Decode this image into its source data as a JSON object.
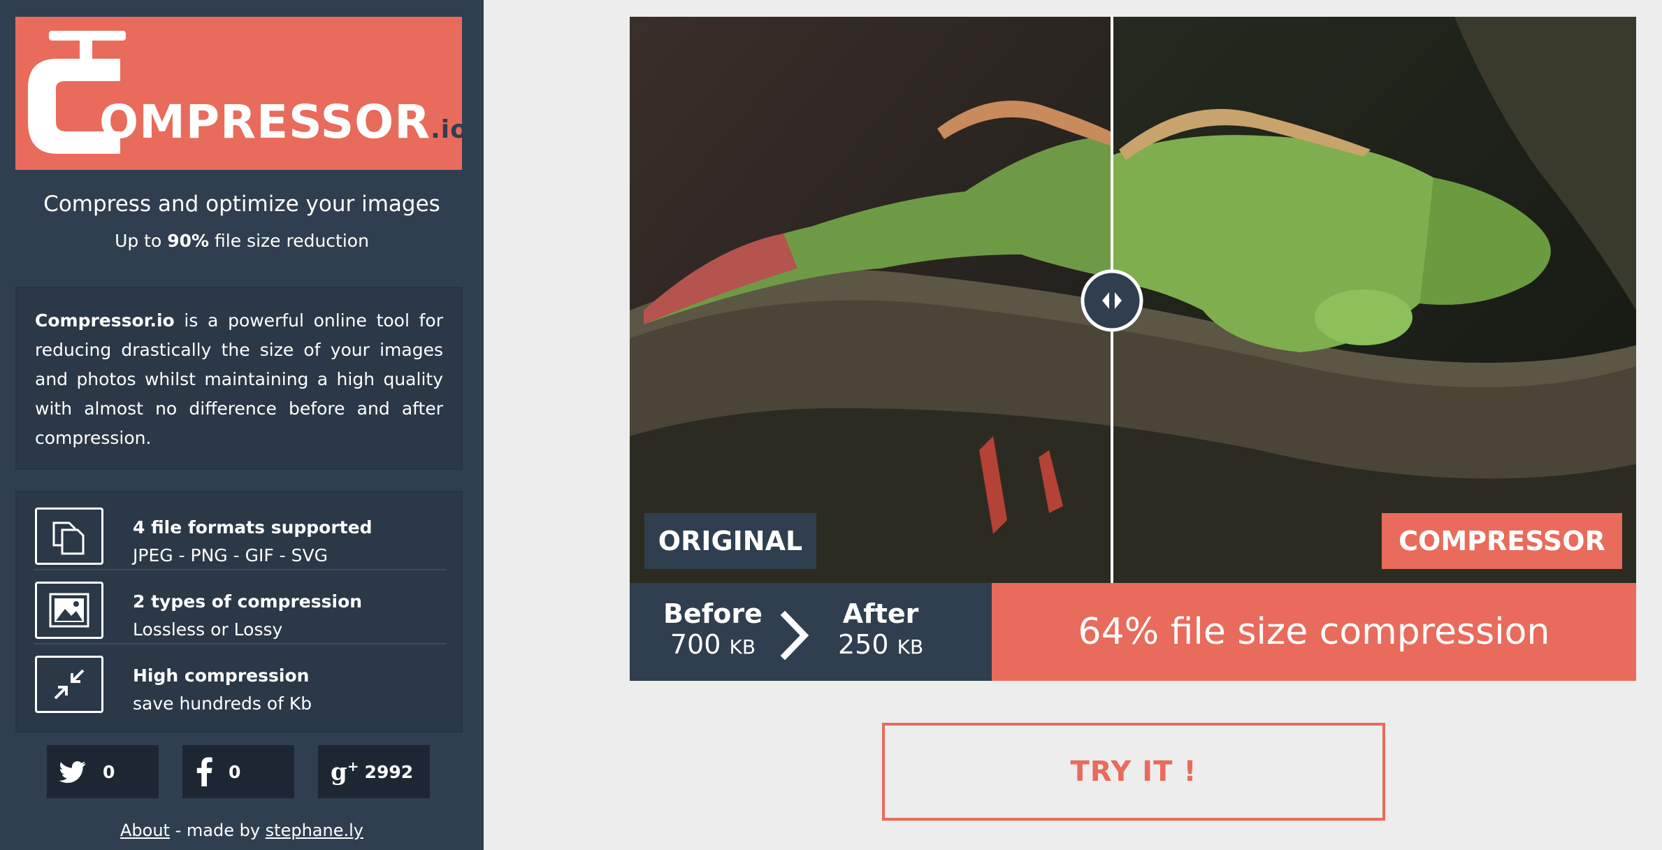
{
  "sidebar": {
    "logo": {
      "text": "OMPRESSOR",
      "suffix": ".io"
    },
    "tagline": "Compress and optimize your images",
    "subtag": {
      "prefix": "Up to ",
      "highlight": "90%",
      "suffix": " file size reduction"
    },
    "description": {
      "brand": "Compressor.io",
      "text": " is a powerful online tool for reducing drastically the size of your images and photos whilst maintaining a high quality with almost no difference before and after compression."
    },
    "features": [
      {
        "title": "4 file formats supported",
        "subtitle": "JPEG - PNG - GIF - SVG",
        "icon": "files-icon"
      },
      {
        "title": "2 types of compression",
        "subtitle": "Lossless or Lossy",
        "icon": "image-icon"
      },
      {
        "title": "High compression",
        "subtitle": "save hundreds of Kb",
        "icon": "compress-arrows-icon"
      }
    ],
    "social": {
      "twitter_count": "0",
      "facebook_count": "0",
      "googleplus_count": "2992"
    },
    "footer": {
      "about": "About",
      "made_by": " - made by ",
      "author": "stephane.ly"
    }
  },
  "preview": {
    "label_original": "ORIGINAL",
    "label_compressed": "COMPRESSOR",
    "before_title": "Before",
    "before_value": "700",
    "before_unit": "KB",
    "after_title": "After",
    "after_value": "250",
    "after_unit": "KB",
    "compression_text": "64% file size compression"
  },
  "cta": {
    "label": "TRY IT !"
  },
  "colors": {
    "accent": "#e96b5b",
    "sidebar": "#2f3f4f",
    "background": "#ededed"
  }
}
